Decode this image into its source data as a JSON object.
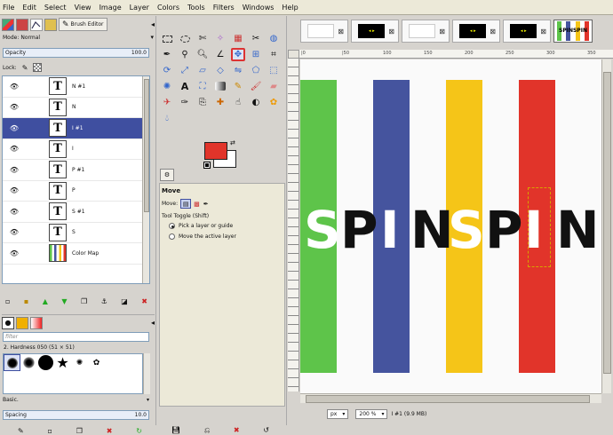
{
  "menu": [
    "File",
    "Edit",
    "Select",
    "View",
    "Image",
    "Layer",
    "Colors",
    "Tools",
    "Filters",
    "Windows",
    "Help"
  ],
  "left_tabs": {
    "brush_editor": "Brush Editor"
  },
  "layers_panel": {
    "mode_label": "Mode:",
    "mode_value": "Normal",
    "opacity_label": "Opacity",
    "opacity_value": "100.0",
    "lock_label": "Lock:",
    "layers": [
      {
        "name": "N #1",
        "thumb": "T",
        "selected": false
      },
      {
        "name": "N",
        "thumb": "T",
        "selected": false
      },
      {
        "name": "I #1",
        "thumb": "T",
        "selected": true
      },
      {
        "name": "I",
        "thumb": "T",
        "selected": false
      },
      {
        "name": "P #1",
        "thumb": "T",
        "selected": false
      },
      {
        "name": "P",
        "thumb": "T",
        "selected": false
      },
      {
        "name": "S #1",
        "thumb": "T",
        "selected": false
      },
      {
        "name": "S",
        "thumb": "T",
        "selected": false
      },
      {
        "name": "Color Map",
        "thumb": "",
        "selected": false
      }
    ]
  },
  "brushes_panel": {
    "filter_placeholder": "filter",
    "brush_name": "2. Hardness 050 (51 × 51)",
    "category": "Basic.",
    "spacing_label": "Spacing",
    "spacing_value": "10.0"
  },
  "tool_options": {
    "title": "Move",
    "move_label": "Move:",
    "toggle_label": "Tool Toggle  (Shift)",
    "options": [
      "Pick a layer or guide",
      "Move the active layer"
    ],
    "selected_option": 0
  },
  "colors": {
    "foreground": "#e1342a",
    "background": "#ffffff",
    "accent_select": "#3f4fa0"
  },
  "canvas": {
    "ruler_labels": [
      "|0",
      "|50",
      "100",
      "150",
      "200",
      "250",
      "300",
      "350"
    ],
    "text_letters": [
      "S",
      "P",
      "I",
      "N",
      "S",
      "P",
      "I",
      "N"
    ],
    "stripe_colors": [
      "#5ec44a",
      "#45549e",
      "#f5c518",
      "#e1342a"
    ]
  },
  "status": {
    "unit": "px",
    "zoom": "200 %",
    "info": "I #1 (9.9 MB)"
  }
}
